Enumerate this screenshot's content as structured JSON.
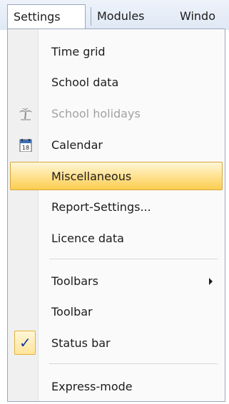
{
  "menubar": {
    "items": [
      {
        "label": "Settings"
      },
      {
        "label": "Modules"
      },
      {
        "label": "Windo"
      }
    ]
  },
  "dropdown": {
    "items": [
      {
        "label": "Time grid"
      },
      {
        "label": "School data"
      },
      {
        "label": "School holidays",
        "icon": "palm-tree-icon",
        "disabled": true
      },
      {
        "label": "Calendar",
        "icon": "calendar-icon",
        "icon_text": "18"
      },
      {
        "label": "Miscellaneous",
        "highlighted": true
      },
      {
        "label": "Report-Settings..."
      },
      {
        "label": "Licence data"
      },
      {
        "label": "Toolbars",
        "submenu": true
      },
      {
        "label": "Toolbar"
      },
      {
        "label": "Status bar",
        "checked": true,
        "check_glyph": "✓"
      },
      {
        "label": "Express-mode"
      }
    ]
  },
  "colors": {
    "highlight": "#ffe08a",
    "highlight_border": "#d6a73a",
    "disabled_text": "#a2a2a2",
    "checkmark": "#123aa0"
  }
}
